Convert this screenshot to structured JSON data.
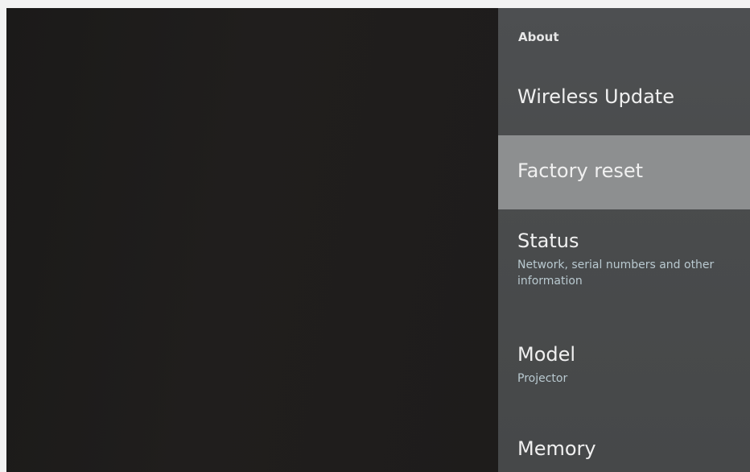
{
  "panel": {
    "title": "About",
    "items": [
      {
        "title": "Wireless Update",
        "subtitle": ""
      },
      {
        "title": "Factory reset",
        "subtitle": ""
      },
      {
        "title": "Status",
        "subtitle": "Network, serial numbers and other information"
      },
      {
        "title": "Model",
        "subtitle": "Projector"
      },
      {
        "title": "Memory",
        "subtitle": ""
      }
    ]
  },
  "colors": {
    "screen_background": "#1d1b1a",
    "panel_background": "#4b4d4f",
    "focused_item": "#8d8f90",
    "subtitle_text": "#b9c9d0"
  }
}
